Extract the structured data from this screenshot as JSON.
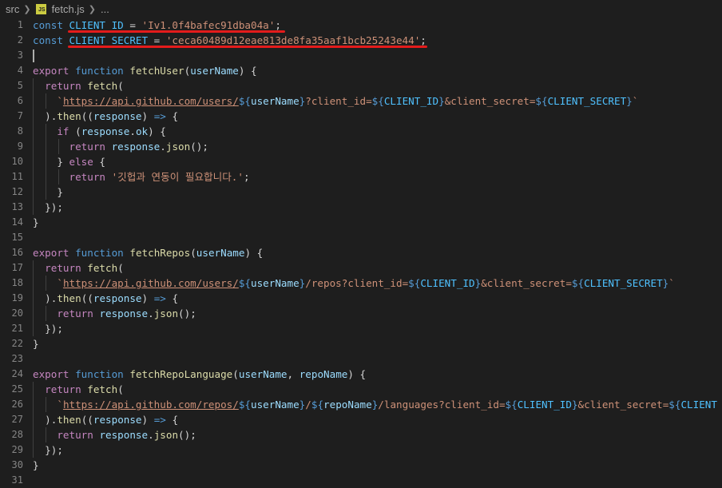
{
  "breadcrumb": {
    "folder": "src",
    "file_icon": "JS",
    "file": "fetch.js",
    "ellipsis": "..."
  },
  "editor": {
    "line_numbers": [
      "1",
      "2",
      "3",
      "4",
      "5",
      "6",
      "7",
      "8",
      "9",
      "10",
      "11",
      "12",
      "13",
      "14",
      "15",
      "16",
      "17",
      "18",
      "19",
      "20",
      "21",
      "22",
      "23",
      "24",
      "25",
      "26",
      "27",
      "28",
      "29",
      "30",
      "31"
    ],
    "lines": [
      [
        [
          "kw",
          "const"
        ],
        [
          "punc",
          " "
        ],
        [
          "const",
          "CLIENT_ID"
        ],
        [
          "punc",
          " = "
        ],
        [
          "str",
          "'Iv1.0f4bafec91dba04a'"
        ],
        [
          "punc",
          ";"
        ]
      ],
      [
        [
          "kw",
          "const"
        ],
        [
          "punc",
          " "
        ],
        [
          "const",
          "CLIENT_SECRET"
        ],
        [
          "punc",
          " = "
        ],
        [
          "str",
          "'ceca60489d12eae813de8fa35aaf1bcb25243e44'"
        ],
        [
          "punc",
          ";"
        ]
      ],
      [],
      [
        [
          "ctl",
          "export"
        ],
        [
          "punc",
          " "
        ],
        [
          "kw",
          "function"
        ],
        [
          "punc",
          " "
        ],
        [
          "fn",
          "fetchUser"
        ],
        [
          "punc",
          "("
        ],
        [
          "var",
          "userName"
        ],
        [
          "punc",
          ") {"
        ]
      ],
      [
        [
          "punc",
          "  "
        ],
        [
          "ctl",
          "return"
        ],
        [
          "punc",
          " "
        ],
        [
          "fn",
          "fetch"
        ],
        [
          "punc",
          "("
        ]
      ],
      [
        [
          "punc",
          "    "
        ],
        [
          "str",
          "`"
        ],
        [
          "link",
          "https://api.github.com/users/"
        ],
        [
          "tpl",
          "${"
        ],
        [
          "var",
          "userName"
        ],
        [
          "tpl",
          "}"
        ],
        [
          "str",
          "?client_id="
        ],
        [
          "tpl",
          "${"
        ],
        [
          "const",
          "CLIENT_ID"
        ],
        [
          "tpl",
          "}"
        ],
        [
          "str",
          "&client_secret="
        ],
        [
          "tpl",
          "${"
        ],
        [
          "const",
          "CLIENT_SECRET"
        ],
        [
          "tpl",
          "}"
        ],
        [
          "str",
          "`"
        ]
      ],
      [
        [
          "punc",
          "  )."
        ],
        [
          "fn",
          "then"
        ],
        [
          "punc",
          "(("
        ],
        [
          "var",
          "response"
        ],
        [
          "punc",
          ") "
        ],
        [
          "kw",
          "=>"
        ],
        [
          "punc",
          " {"
        ]
      ],
      [
        [
          "punc",
          "    "
        ],
        [
          "ctl",
          "if"
        ],
        [
          "punc",
          " ("
        ],
        [
          "var",
          "response"
        ],
        [
          "punc",
          "."
        ],
        [
          "var",
          "ok"
        ],
        [
          "punc",
          ") {"
        ]
      ],
      [
        [
          "punc",
          "      "
        ],
        [
          "ctl",
          "return"
        ],
        [
          "punc",
          " "
        ],
        [
          "var",
          "response"
        ],
        [
          "punc",
          "."
        ],
        [
          "fn",
          "json"
        ],
        [
          "punc",
          "();"
        ]
      ],
      [
        [
          "punc",
          "    } "
        ],
        [
          "ctl",
          "else"
        ],
        [
          "punc",
          " {"
        ]
      ],
      [
        [
          "punc",
          "      "
        ],
        [
          "ctl",
          "return"
        ],
        [
          "punc",
          " "
        ],
        [
          "str",
          "'깃헙과 연동이 필요합니다.'"
        ],
        [
          "punc",
          ";"
        ]
      ],
      [
        [
          "punc",
          "    }"
        ]
      ],
      [
        [
          "punc",
          "  });"
        ]
      ],
      [
        [
          "punc",
          "}"
        ]
      ],
      [],
      [
        [
          "ctl",
          "export"
        ],
        [
          "punc",
          " "
        ],
        [
          "kw",
          "function"
        ],
        [
          "punc",
          " "
        ],
        [
          "fn",
          "fetchRepos"
        ],
        [
          "punc",
          "("
        ],
        [
          "var",
          "userName"
        ],
        [
          "punc",
          ") {"
        ]
      ],
      [
        [
          "punc",
          "  "
        ],
        [
          "ctl",
          "return"
        ],
        [
          "punc",
          " "
        ],
        [
          "fn",
          "fetch"
        ],
        [
          "punc",
          "("
        ]
      ],
      [
        [
          "punc",
          "    "
        ],
        [
          "str",
          "`"
        ],
        [
          "link",
          "https://api.github.com/users/"
        ],
        [
          "tpl",
          "${"
        ],
        [
          "var",
          "userName"
        ],
        [
          "tpl",
          "}"
        ],
        [
          "str",
          "/repos?client_id="
        ],
        [
          "tpl",
          "${"
        ],
        [
          "const",
          "CLIENT_ID"
        ],
        [
          "tpl",
          "}"
        ],
        [
          "str",
          "&client_secret="
        ],
        [
          "tpl",
          "${"
        ],
        [
          "const",
          "CLIENT_SECRET"
        ],
        [
          "tpl",
          "}"
        ],
        [
          "str",
          "`"
        ]
      ],
      [
        [
          "punc",
          "  )."
        ],
        [
          "fn",
          "then"
        ],
        [
          "punc",
          "(("
        ],
        [
          "var",
          "response"
        ],
        [
          "punc",
          ") "
        ],
        [
          "kw",
          "=>"
        ],
        [
          "punc",
          " {"
        ]
      ],
      [
        [
          "punc",
          "    "
        ],
        [
          "ctl",
          "return"
        ],
        [
          "punc",
          " "
        ],
        [
          "var",
          "response"
        ],
        [
          "punc",
          "."
        ],
        [
          "fn",
          "json"
        ],
        [
          "punc",
          "();"
        ]
      ],
      [
        [
          "punc",
          "  });"
        ]
      ],
      [
        [
          "punc",
          "}"
        ]
      ],
      [],
      [
        [
          "ctl",
          "export"
        ],
        [
          "punc",
          " "
        ],
        [
          "kw",
          "function"
        ],
        [
          "punc",
          " "
        ],
        [
          "fn",
          "fetchRepoLanguage"
        ],
        [
          "punc",
          "("
        ],
        [
          "var",
          "userName"
        ],
        [
          "punc",
          ", "
        ],
        [
          "var",
          "repoName"
        ],
        [
          "punc",
          ") {"
        ]
      ],
      [
        [
          "punc",
          "  "
        ],
        [
          "ctl",
          "return"
        ],
        [
          "punc",
          " "
        ],
        [
          "fn",
          "fetch"
        ],
        [
          "punc",
          "("
        ]
      ],
      [
        [
          "punc",
          "    "
        ],
        [
          "str",
          "`"
        ],
        [
          "link",
          "https://api.github.com/repos/"
        ],
        [
          "tpl",
          "${"
        ],
        [
          "var",
          "userName"
        ],
        [
          "tpl",
          "}"
        ],
        [
          "str",
          "/"
        ],
        [
          "tpl",
          "${"
        ],
        [
          "var",
          "repoName"
        ],
        [
          "tpl",
          "}"
        ],
        [
          "str",
          "/languages?client_id="
        ],
        [
          "tpl",
          "${"
        ],
        [
          "const",
          "CLIENT_ID"
        ],
        [
          "tpl",
          "}"
        ],
        [
          "str",
          "&client_secret="
        ],
        [
          "tpl",
          "${"
        ],
        [
          "const",
          "CLIENT"
        ]
      ],
      [
        [
          "punc",
          "  )."
        ],
        [
          "fn",
          "then"
        ],
        [
          "punc",
          "(("
        ],
        [
          "var",
          "response"
        ],
        [
          "punc",
          ") "
        ],
        [
          "kw",
          "=>"
        ],
        [
          "punc",
          " {"
        ]
      ],
      [
        [
          "punc",
          "    "
        ],
        [
          "ctl",
          "return"
        ],
        [
          "punc",
          " "
        ],
        [
          "var",
          "response"
        ],
        [
          "punc",
          "."
        ],
        [
          "fn",
          "json"
        ],
        [
          "punc",
          "();"
        ]
      ],
      [
        [
          "punc",
          "  });"
        ]
      ],
      [
        [
          "punc",
          "}"
        ]
      ],
      []
    ]
  },
  "colors": {
    "background": "#1e1e1e",
    "annotation_underline": "#e41b1b",
    "cursor": "#aeafad"
  }
}
